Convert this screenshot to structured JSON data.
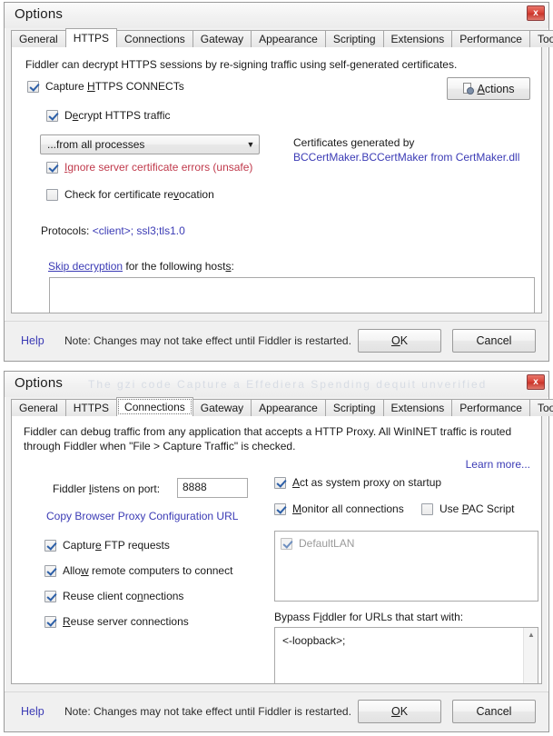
{
  "dialogs": [
    {
      "id": "https",
      "title": "Options",
      "ghost_title": "",
      "close_label": "x",
      "tabs": [
        {
          "label": "General",
          "selected": false
        },
        {
          "label": "HTTPS",
          "selected": true
        },
        {
          "label": "Connections",
          "selected": false
        },
        {
          "label": "Gateway",
          "selected": false
        },
        {
          "label": "Appearance",
          "selected": false
        },
        {
          "label": "Scripting",
          "selected": false
        },
        {
          "label": "Extensions",
          "selected": false
        },
        {
          "label": "Performance",
          "selected": false
        },
        {
          "label": "Tools",
          "selected": false
        }
      ],
      "description": "Fiddler can decrypt HTTPS sessions by re-signing traffic using self-generated certificates.",
      "capture_connects": {
        "label_a": "Capture ",
        "label_mnemonic": "H",
        "label_b": "TTPS CONNECTs",
        "checked": true
      },
      "actions_button": {
        "label": "Actions",
        "mnemonic": "A",
        "icon": "page-gear-icon"
      },
      "decrypt_traffic": {
        "label_a": "D",
        "label_mnemonic": "e",
        "label_b": "crypt HTTPS traffic",
        "checked": true
      },
      "process_combo": {
        "value": "...from all processes",
        "arrow": "▼"
      },
      "ignore_cert_errors": {
        "label_mnemonic": "I",
        "label_a": "gnore server certificate errors (unsafe)",
        "checked": true,
        "color": "#c0394b"
      },
      "check_revocation": {
        "label_a": "Check for certificate re",
        "label_mnemonic": "v",
        "label_b": "ocation",
        "checked": false
      },
      "protocols": {
        "label": "Protocols:",
        "value": "<client>; ssl3;tls1.0"
      },
      "skip_decryption": {
        "link": "Skip decryption",
        "rest_a": " for the following host",
        "rest_mnemonic": "s",
        "rest_b": ":"
      },
      "hosts_textarea": {
        "value": ""
      },
      "footer": {
        "help": "Help",
        "note": "Note: Changes may not take effect until Fiddler is restarted.",
        "ok": "OK",
        "ok_mnemonic": "O",
        "cancel": "Cancel"
      }
    },
    {
      "id": "connections",
      "title": "Options",
      "ghost_title": "The gzi code   Capture  a Effediera Spending dequit   unverified",
      "close_label": "x",
      "tabs": [
        {
          "label": "General",
          "selected": false
        },
        {
          "label": "HTTPS",
          "selected": false
        },
        {
          "label": "Connections",
          "selected": true
        },
        {
          "label": "Gateway",
          "selected": false
        },
        {
          "label": "Appearance",
          "selected": false
        },
        {
          "label": "Scripting",
          "selected": false
        },
        {
          "label": "Extensions",
          "selected": false
        },
        {
          "label": "Performance",
          "selected": false
        },
        {
          "label": "Tools",
          "selected": false
        }
      ],
      "description_line1": "Fiddler can debug traffic from any application that accepts a HTTP Proxy. All WinINET traffic is routed",
      "description_line2": "through Fiddler when \"File > Capture Traffic\" is checked.",
      "learn_more": "Learn more...",
      "port_label": {
        "a": "Fiddler ",
        "mnemonic": "l",
        "b": "istens on port:"
      },
      "port_value": "8888",
      "copy_proxy_url": "Copy Browser Proxy Configuration URL",
      "left_checkboxes": [
        {
          "label_a": "Captur",
          "label_mnemonic": "e",
          "label_b": " FTP requests",
          "checked": true
        },
        {
          "label_a": "Allo",
          "label_mnemonic": "w",
          "label_b": " remote computers to connect",
          "checked": true
        },
        {
          "label_a": "Reuse client co",
          "label_mnemonic": "n",
          "label_b": "nections",
          "checked": true
        },
        {
          "label_a": "",
          "label_mnemonic": "R",
          "label_b": "euse server connections",
          "checked": true
        }
      ],
      "right_checkboxes": [
        {
          "label_a": "",
          "label_mnemonic": "A",
          "label_b": "ct as system proxy on startup",
          "checked": true
        },
        {
          "label_a": "",
          "label_mnemonic": "M",
          "label_b": "onitor all connections",
          "checked": true
        }
      ],
      "use_pac_script": {
        "label_a": "Use ",
        "label_mnemonic": "P",
        "label_b": "AC Script",
        "checked": false
      },
      "lan_list": [
        {
          "label": "DefaultLAN",
          "checked": true,
          "disabled": true
        }
      ],
      "bypass_label": {
        "a": "Bypass F",
        "mnemonic": "i",
        "b": "ddler for URLs that start with:"
      },
      "bypass_value": "<-loopback>;",
      "scroll_up": "▲",
      "scroll_down": "▼",
      "footer": {
        "help": "Help",
        "note": "Note: Changes may not take effect until Fiddler is restarted.",
        "ok": "OK",
        "ok_mnemonic": "O",
        "cancel": "Cancel"
      }
    }
  ]
}
